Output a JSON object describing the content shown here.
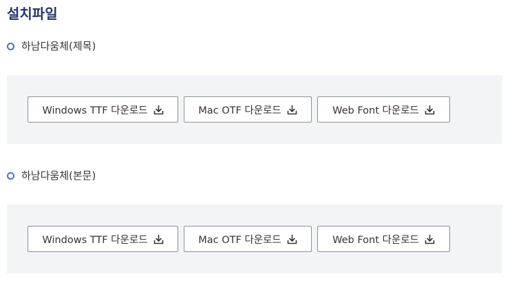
{
  "page": {
    "title": "설치파일"
  },
  "sections": [
    {
      "label": "하남다움체(제목)",
      "buttons": [
        {
          "label": "Windows TTF 다운로드",
          "icon": "download-icon"
        },
        {
          "label": "Mac OTF 다운로드",
          "icon": "download-icon"
        },
        {
          "label": "Web Font 다운로드",
          "icon": "download-icon"
        }
      ]
    },
    {
      "label": "하남다움체(본문)",
      "buttons": [
        {
          "label": "Windows TTF 다운로드",
          "icon": "download-icon"
        },
        {
          "label": "Mac OTF 다운로드",
          "icon": "download-icon"
        },
        {
          "label": "Web Font 다운로드",
          "icon": "download-icon"
        }
      ]
    }
  ],
  "colors": {
    "title": "#27336b",
    "bullet": "#3f72c9",
    "box_background": "#f2f4f7",
    "button_border": "#8a8f99"
  }
}
